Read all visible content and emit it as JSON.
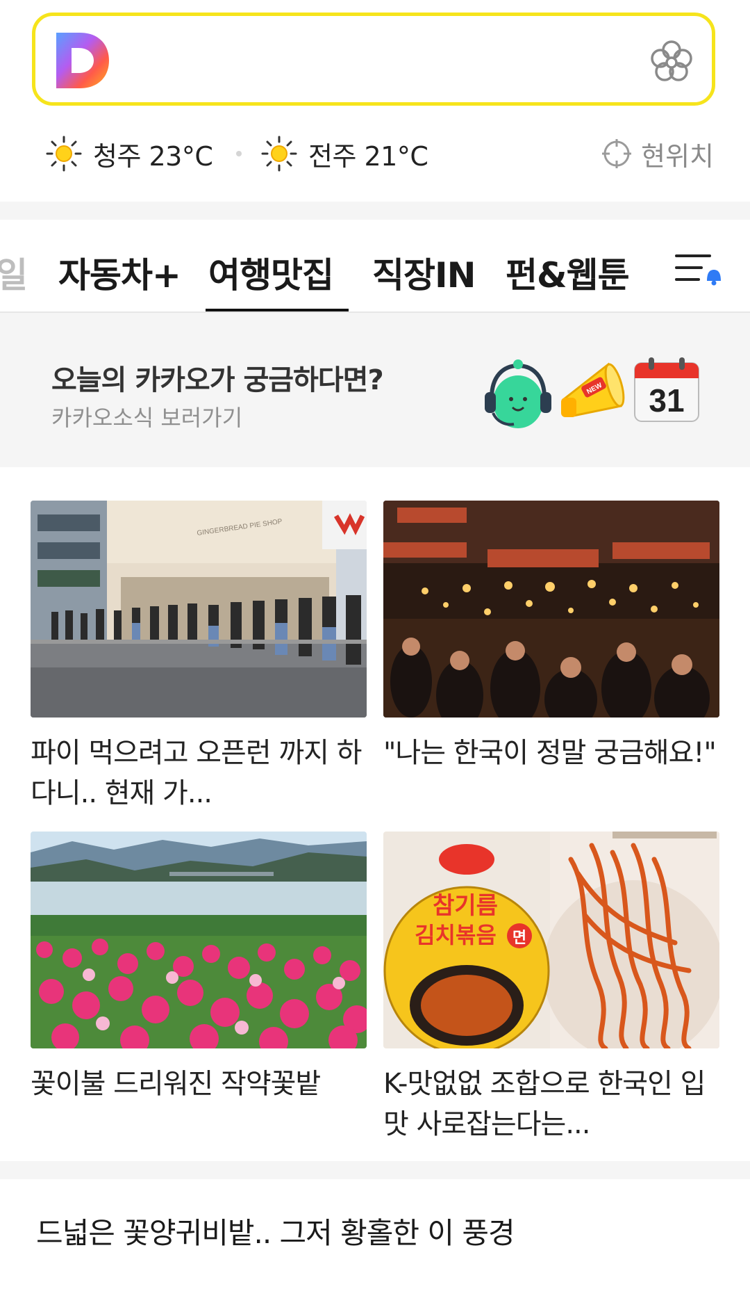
{
  "search": {
    "logo_name": "daum-logo",
    "right_icon": "flower-icon"
  },
  "weather": [
    {
      "city_temp": "청주 23°C",
      "icon": "sun-icon"
    },
    {
      "city_temp": "전주 21°C",
      "icon": "sun-icon"
    }
  ],
  "location": {
    "label": "현위치",
    "icon": "crosshair-icon"
  },
  "tabs": [
    {
      "label": "일",
      "state": "faded"
    },
    {
      "label": "자동차+",
      "state": "normal"
    },
    {
      "label": "여행맛집",
      "state": "selected"
    },
    {
      "label": "직장IN",
      "state": "normal"
    },
    {
      "label": "펀&웹툰",
      "state": "normal"
    }
  ],
  "menu": {
    "icon": "menu-bell-icon"
  },
  "banner": {
    "title": "오늘의 카카오가 궁금하다면?",
    "subtitle": "카카오소식 보러가기",
    "badge_text": "NEW",
    "calendar_day": "31"
  },
  "articles": [
    {
      "caption": "파이 먹으려고 오픈런 까지 하다니.. 현재 가...",
      "image": "pie-shop-queue-photo",
      "sign": "GINGERBREAD PIE SHOP"
    },
    {
      "caption": "\"나는 한국이 정말 궁금해요!\"",
      "image": "night-market-photo"
    },
    {
      "caption": "꽃이불 드리워진 작약꽃밭",
      "image": "peony-field-photo"
    },
    {
      "caption": "K-맛없없 조합으로 한국인 입맛 사로잡는다는...",
      "image": "ramen-cup-photo",
      "product_lines": [
        "참기름",
        "김치볶음",
        "면"
      ]
    }
  ],
  "bottom_headline": "드넓은 꽃양귀비밭.. 그저 황홀한 이 풍경",
  "colors": {
    "search_border": "#f6e41c",
    "bg_gray": "#f5f5f5",
    "tab_text": "#1a1a1a"
  }
}
